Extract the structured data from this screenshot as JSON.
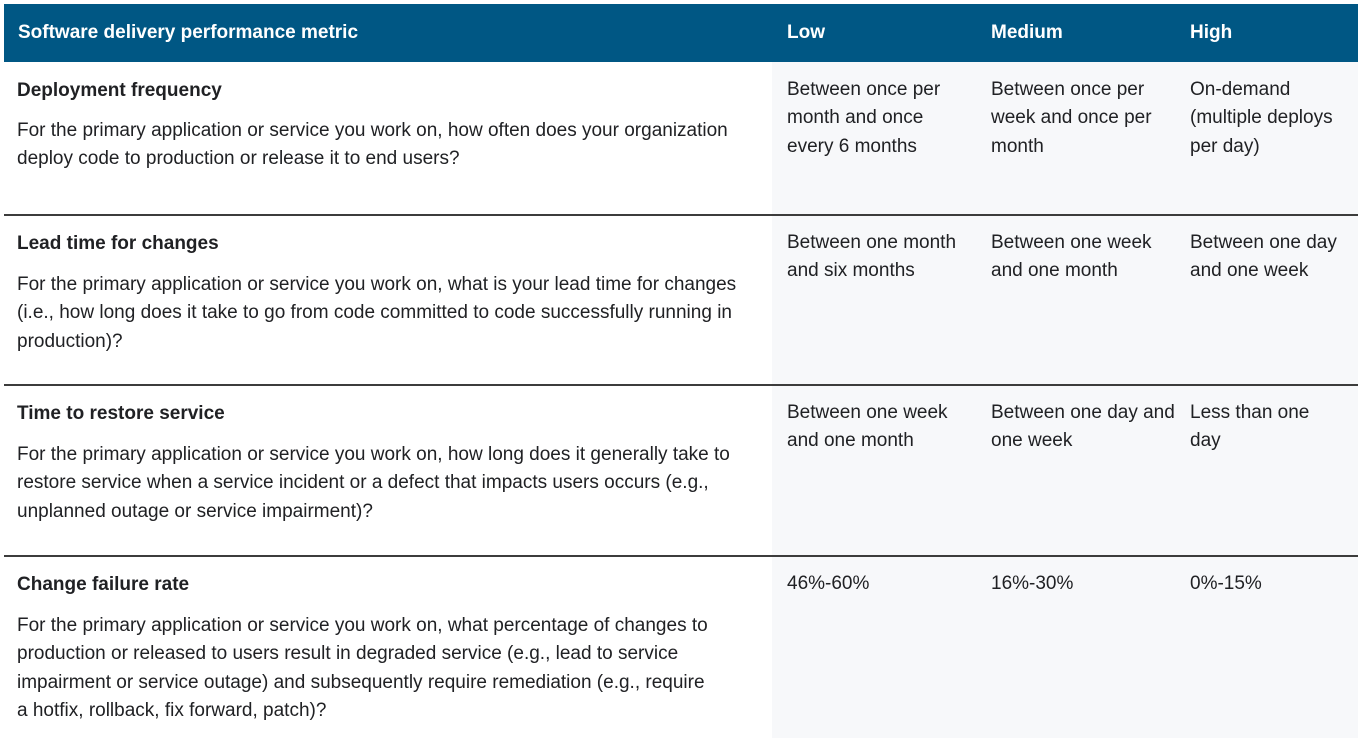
{
  "header": {
    "metric": "Software delivery performance metric",
    "low": "Low",
    "medium": "Medium",
    "high": "High"
  },
  "colors": {
    "header_bg": "#005784",
    "header_text": "#ffffff",
    "value_panel_bg": "#f7f8fa",
    "divider": "#3c3c3c"
  },
  "rows": [
    {
      "title": "Deployment frequency",
      "description": "For the primary application or service you work on, how often does your organization deploy code to production or release it to end users?",
      "low": "Between once per month and once every 6 months",
      "medium": "Between once per week and once per month",
      "high": "On-demand (multiple deploys per day)"
    },
    {
      "title": "Lead time for changes",
      "description": "For the primary application or service you work on, what is your lead time for changes (i.e., how long does it take to go from code committed to code successfully running in production)?",
      "low": "Between one month and six months",
      "medium": "Between one week and one month",
      "high": "Between one day and one week"
    },
    {
      "title": "Time to restore service",
      "description": "For the primary application or service you work on, how long does it generally take to restore service when a service incident or a defect that impacts users occurs (e.g., unplanned outage or service impairment)?",
      "low": "Between one week and one month",
      "medium": "Between one day and one week",
      "high": "Less than one day"
    },
    {
      "title": "Change failure rate",
      "description": "For the primary application or service you work on, what percentage of changes to production or released to users result in degraded service (e.g., lead to service impairment or service outage) and subsequently require remediation (e.g., require a hotfix, rollback, fix forward, patch)?",
      "low": "46%-60%",
      "medium": "16%-30%",
      "high": "0%-15%"
    }
  ]
}
